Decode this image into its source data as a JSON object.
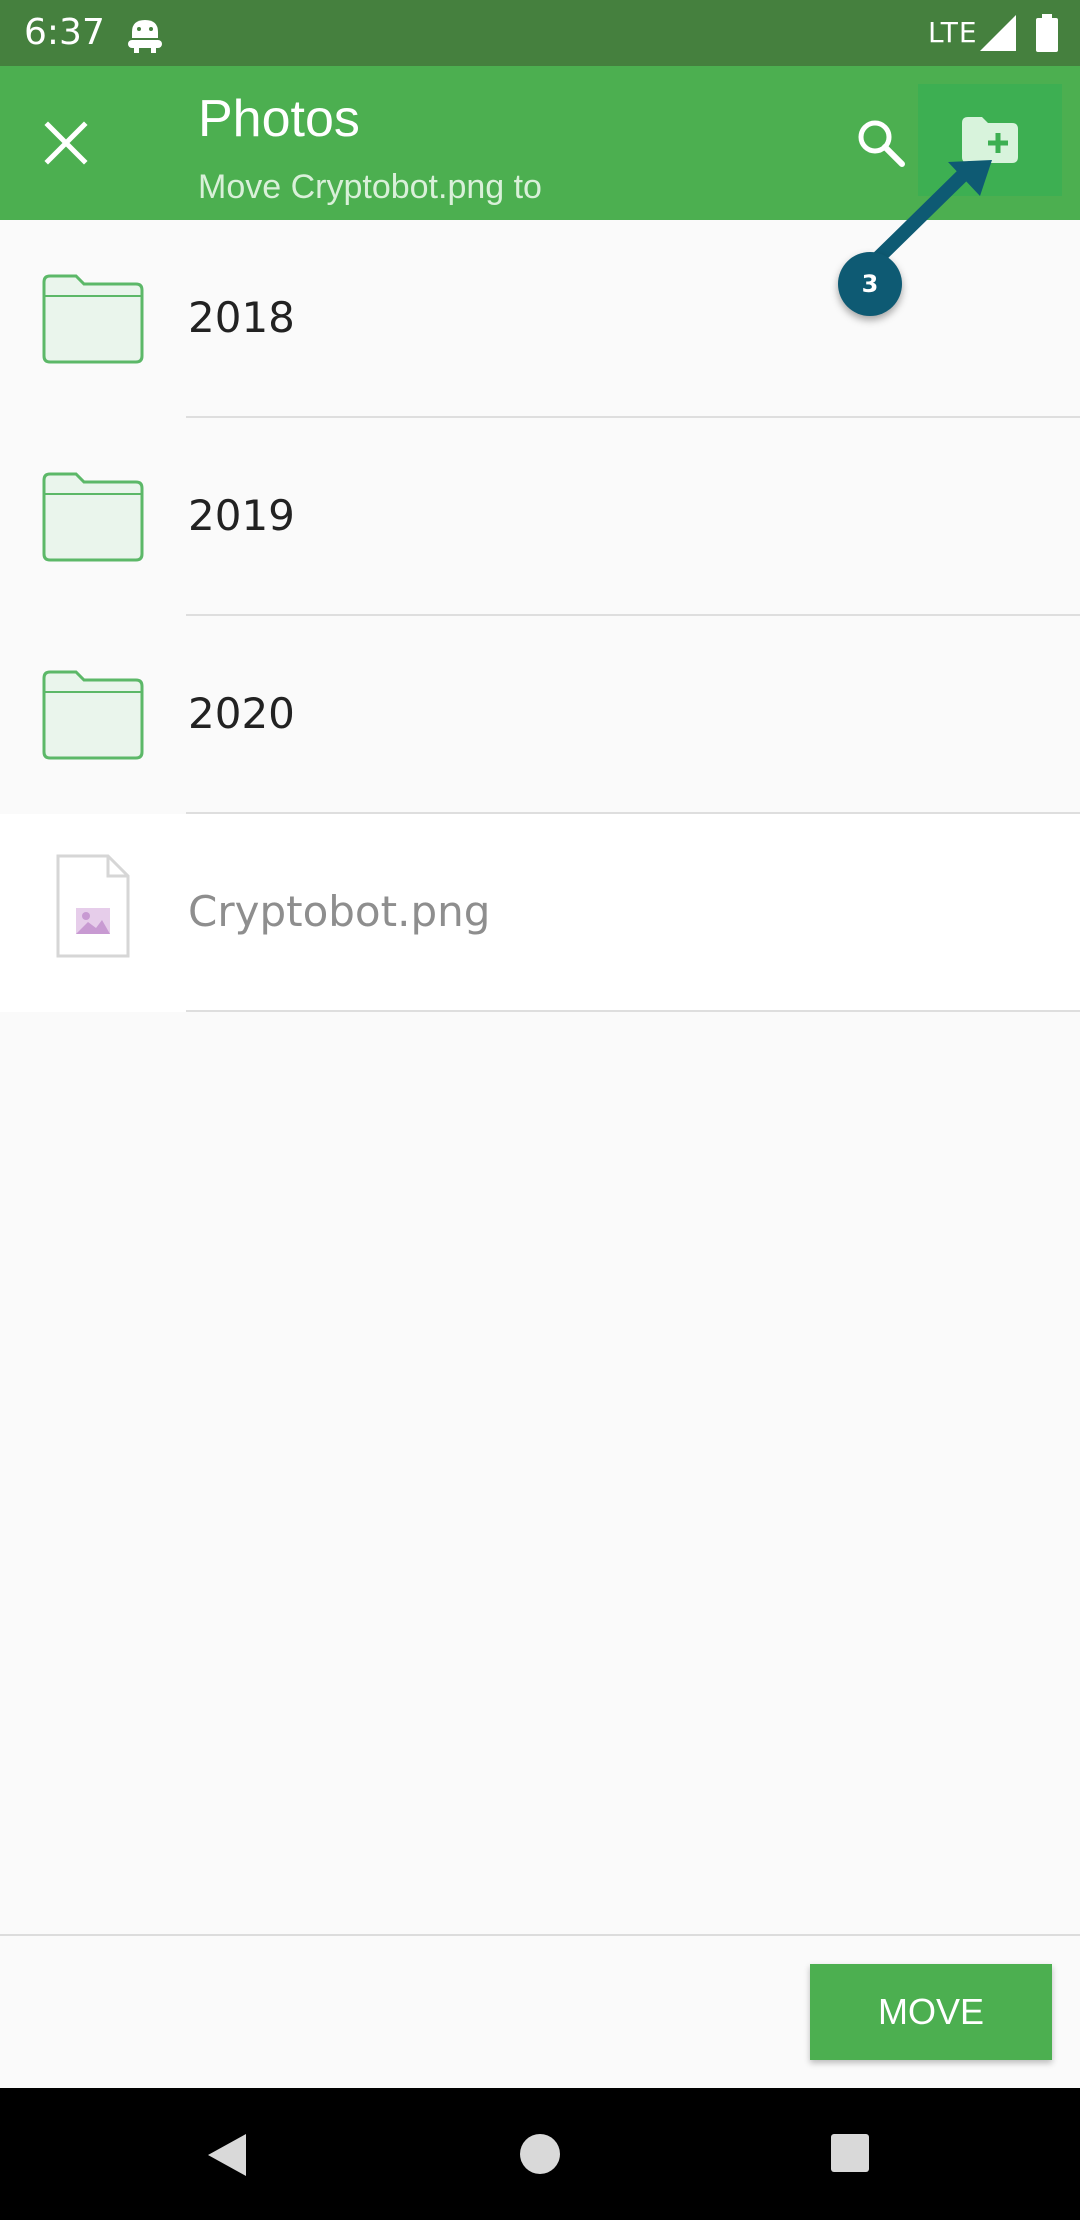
{
  "status_bar": {
    "time": "6:37",
    "network": "LTE",
    "icons": [
      "android-app-icon",
      "signal-icon",
      "battery-icon"
    ]
  },
  "app_bar": {
    "title": "Photos",
    "subtitle": "Move Cryptobot.png to",
    "icons": [
      "close-icon",
      "search-icon",
      "new-folder-icon"
    ]
  },
  "list": {
    "items": [
      {
        "label": "2018",
        "type": "folder"
      },
      {
        "label": "2019",
        "type": "folder"
      },
      {
        "label": "2020",
        "type": "folder"
      },
      {
        "label": "Cryptobot.png",
        "type": "file"
      }
    ]
  },
  "callout": {
    "badge": "3"
  },
  "actions": {
    "move_label": "MOVE"
  },
  "navigation": {
    "icons": [
      "back-icon",
      "home-icon",
      "recents-icon"
    ]
  },
  "colors": {
    "status_bar": "#45803e",
    "app_bar": "#4caf50",
    "accent": "#4caf50",
    "callout": "#0e5a73"
  }
}
